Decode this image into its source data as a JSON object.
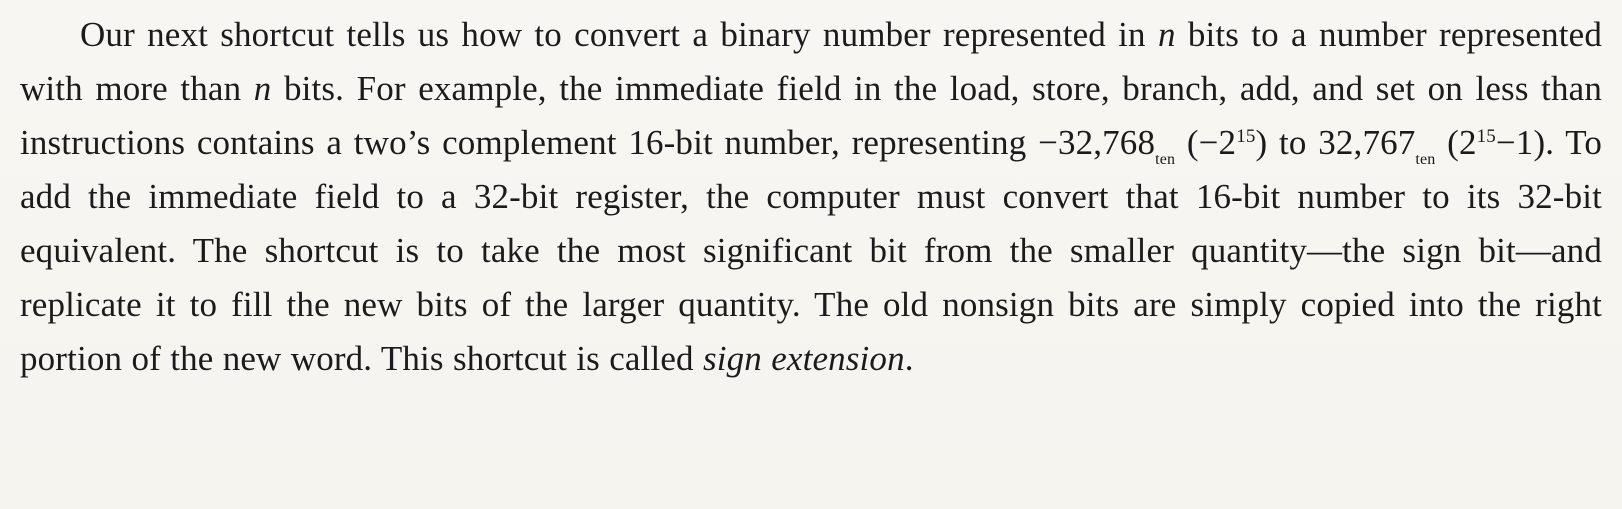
{
  "paragraph": {
    "s1": "Our next shortcut tells us how to convert a binary number represented in ",
    "n1": "n",
    "s2": " bits to a number represented with more than ",
    "n2": "n",
    "s3": " bits. For example, the immediate field in the load, store, branch, add, and set on less than instructions contains a two’s complement 16-bit number, representing −32,768",
    "sub1": "ten",
    "s4": " (−2",
    "sup1": "15",
    "s5": ") to 32,767",
    "sub2": "ten",
    "s6": " (2",
    "sup2": "15",
    "s7": "−1). To add the immediate field to a 32-bit register, the computer must convert that 16-bit number to its 32-bit equivalent. The shortcut is to take the most significant bit from the smaller quantity—the sign bit—and replicate it to fill the new bits of the larger quantity. The old nonsign bits are simply copied into the right portion of the new word. This shortcut is called ",
    "term": "sign extension",
    "s8": "."
  }
}
